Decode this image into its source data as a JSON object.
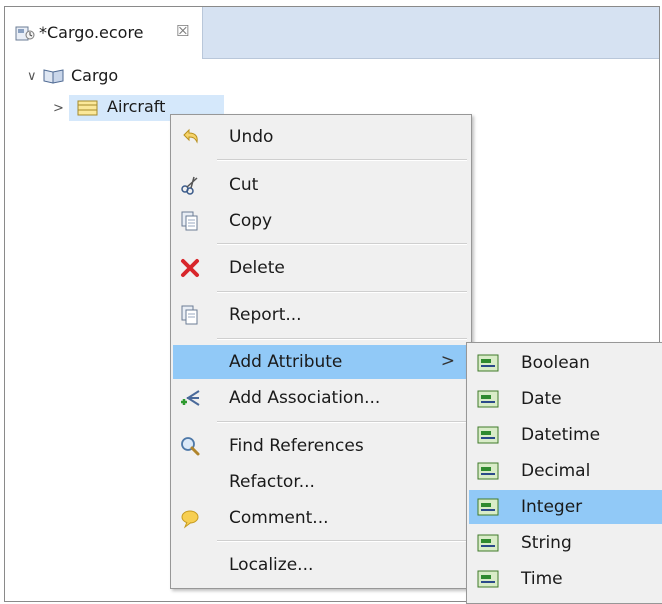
{
  "editor": {
    "tab_label": "*Cargo.ecore",
    "tab_close": "☒"
  },
  "tree": {
    "root": {
      "label": "Cargo",
      "twisty": "∨",
      "icon": "package-icon"
    },
    "child": {
      "label": "Aircraft",
      "twisty": ">",
      "icon": "class-icon"
    }
  },
  "context_menu": {
    "items": [
      {
        "label": "Undo",
        "icon": "undo-icon"
      },
      {
        "label": "Cut",
        "icon": "scissors-icon"
      },
      {
        "label": "Copy",
        "icon": "copy-icon"
      },
      {
        "label": "Delete",
        "icon": "delete-x-icon"
      },
      {
        "label": "Report...",
        "icon": "report-icon"
      },
      {
        "label": "Add Attribute",
        "arrow": ">"
      },
      {
        "label": "Add Association...",
        "icon": "add-association-icon"
      },
      {
        "label": "Find References",
        "icon": "magnifier-icon"
      },
      {
        "label": "Refactor..."
      },
      {
        "label": "Comment...",
        "icon": "comment-icon"
      },
      {
        "label": "Localize..."
      }
    ]
  },
  "submenu": {
    "items": [
      {
        "label": "Boolean"
      },
      {
        "label": "Date"
      },
      {
        "label": "Datetime"
      },
      {
        "label": "Decimal"
      },
      {
        "label": "Integer"
      },
      {
        "label": "String"
      },
      {
        "label": "Time"
      }
    ],
    "icon": "attribute-icon"
  },
  "colors": {
    "highlight": "#91c9f7",
    "tree_selection": "#d5e8fb",
    "tab_bar": "#d6e2f2"
  }
}
